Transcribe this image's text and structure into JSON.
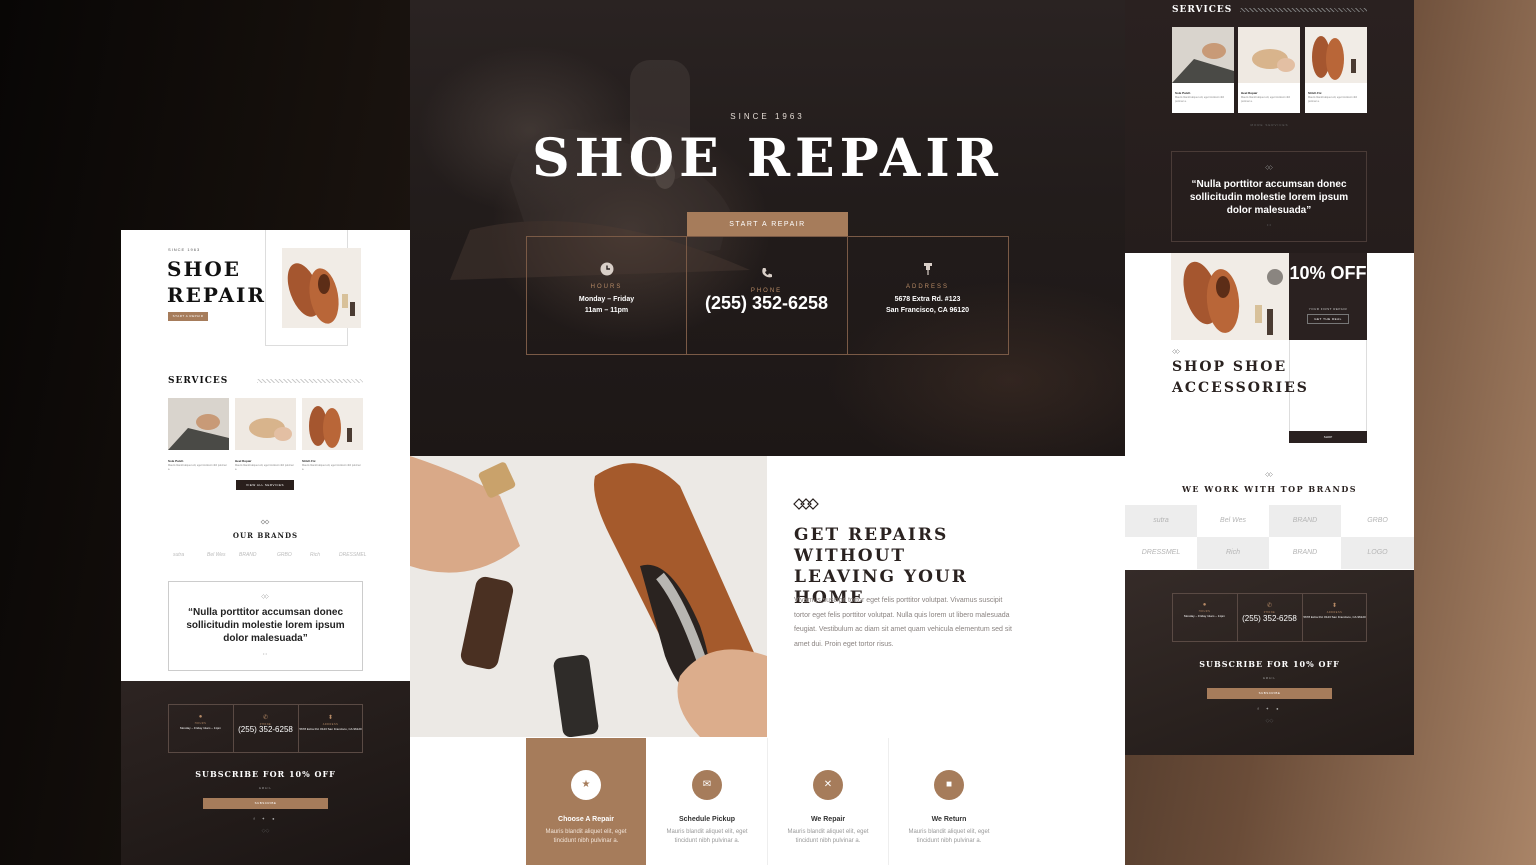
{
  "colors": {
    "accent": "#a67c5b",
    "dark": "#2a2120",
    "text": "#2a2220"
  },
  "left": {
    "since": "SINCE 1963",
    "title": "SHOE REPAIR",
    "cta": "START A REPAIR",
    "services_title": "SERVICES",
    "services": [
      {
        "name": "Sole Patch",
        "desc": "Mauris blandit aliquet elit, eget tincidunt nibh pulvinar a."
      },
      {
        "name": "Heel Repair",
        "desc": "Mauris blandit aliquet elit, eget tincidunt nibh pulvinar a."
      },
      {
        "name": "Stitch Fix",
        "desc": "Mauris blandit aliquet elit, eget tincidunt nibh pulvinar a."
      }
    ],
    "view_all": "VIEW ALL SERVICES",
    "brands_title": "OUR BRANDS",
    "brands": [
      "sutra",
      "Bel Wes",
      "BRAND",
      "GRBO",
      "Rich",
      "DRESSMEL"
    ],
    "testimonial": "“Nulla porttitor accumsan donec sollicitudin molestie lorem ipsum dolor malesuada”",
    "info": {
      "hours_label": "HOURS",
      "hours": "Monday – Friday 11am – 11pm",
      "phone_label": "PHONE",
      "phone": "(255) 352-6258",
      "address_label": "ADDRESS",
      "address": "5678 Extra Rd. #123 San Francisco, CA 96120"
    },
    "subscribe_title": "SUBSCRIBE FOR 10% OFF",
    "email_label": "EMAIL",
    "subscribe_btn": "SUBSCRIBE",
    "social": "f ✦ ●"
  },
  "center": {
    "since": "SINCE 1963",
    "title": "SHOE REPAIR",
    "start_btn": "START A REPAIR",
    "info": {
      "hours_label": "HOURS",
      "hours_line1": "Monday – Friday",
      "hours_line2": "11am – 11pm",
      "phone_label": "PHONE",
      "phone": "(255) 352-6258",
      "address_label": "ADDRESS",
      "address_line1": "5678 Extra Rd. #123",
      "address_line2": "San Francisco, CA 96120"
    },
    "repairs_title": "GET REPAIRS WITHOUT LEAVING YOUR HOME",
    "repairs_body": "Vivamus suscipit tortor eget felis porttitor volutpat. Vivamus suscipit tortor eget felis porttitor volutpat. Nulla quis lorem ut libero malesuada feugiat. Vestibulum ac diam sit amet quam vehicula elementum sed sit amet dui. Proin eget tortor risus.",
    "steps": [
      {
        "name": "Choose A Repair",
        "desc": "Mauris blandit aliquet elit, eget tincidunt nibh pulvinar a.",
        "icon": "star-icon"
      },
      {
        "name": "Schedule Pickup",
        "desc": "Mauris blandit aliquet elit, eget tincidunt nibh pulvinar a.",
        "icon": "mail-icon"
      },
      {
        "name": "We Repair",
        "desc": "Mauris blandit aliquet elit, eget tincidunt nibh pulvinar a.",
        "icon": "tools-icon"
      },
      {
        "name": "We Return",
        "desc": "Mauris blandit aliquet elit, eget tincidunt nibh pulvinar a.",
        "icon": "box-icon"
      }
    ]
  },
  "right": {
    "services_title": "SERVICES",
    "services": [
      {
        "name": "Sole Patch",
        "desc": "Mauris blandit aliquet elit, eget tincidunt nibh pulvinar a."
      },
      {
        "name": "Heel Repair",
        "desc": "Mauris blandit aliquet elit, eget tincidunt nibh pulvinar a."
      },
      {
        "name": "Stitch Fix",
        "desc": "Mauris blandit aliquet elit, eget tincidunt nibh pulvinar a."
      }
    ],
    "more_services": "MORE SERVICES",
    "testimonial": "“Nulla porttitor accumsan donec sollicitudin molestie lorem ipsum dolor malesuada”",
    "offer": "10% OFF",
    "offer_sub": "YOUR FIRST REPAIR",
    "offer_btn": "GET THE DEAL",
    "shop_title": "SHOP SHOE ACCESSORIES",
    "shop_btn": "SHOP",
    "brands_title": "WE WORK WITH TOP BRANDS",
    "brands": [
      "sutra",
      "Bel Wes",
      "BRAND",
      "GRBO",
      "DRESSMEL",
      "Rich",
      "BRAND",
      "LOGO"
    ],
    "info": {
      "hours_label": "HOURS",
      "hours": "Monday – Friday 11am – 11pm",
      "phone_label": "PHONE",
      "phone": "(255) 352-6258",
      "address_label": "ADDRESS",
      "address": "5678 Extra Rd. #123 San Francisco, CA 96120"
    },
    "subscribe_title": "SUBSCRIBE FOR 10% OFF",
    "email_label": "EMAIL",
    "subscribe_btn": "SUBSCRIBE",
    "social": "f ✦ ●"
  }
}
